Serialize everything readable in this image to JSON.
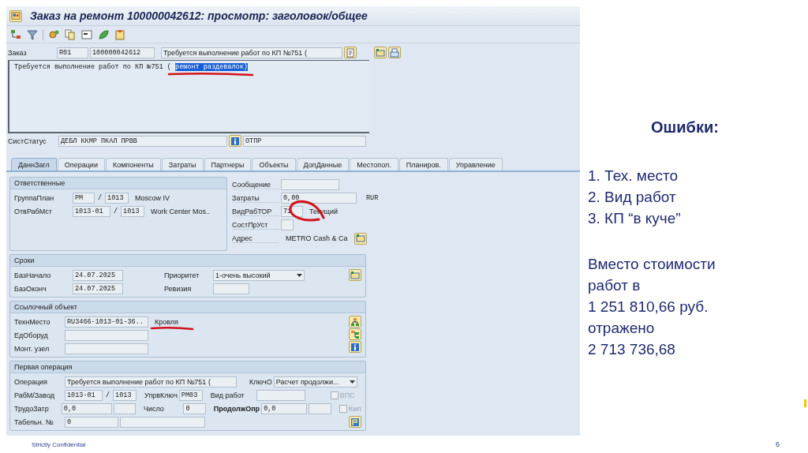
{
  "window": {
    "title": "Заказ на ремонт 100000042612: просмотр: заголовок/общее"
  },
  "header": {
    "order_label": "Заказ",
    "order_type": "R01",
    "order_number": "100000042612",
    "short_text": "Требуется выполнение работ по КП №751 (",
    "long_text": [
      {
        "text": "Требуется выполнение работ по КП №751 ( ",
        "selected": false
      },
      {
        "text": "ремонт раздевалок)",
        "selected": true
      }
    ],
    "status_label": "СистСтатус",
    "system_status": "ДЕБЛ ККМР ПКАЛ ПРВВ",
    "user_status": "ОТПР"
  },
  "tabs": [
    {
      "label": "ДаннЗагл",
      "selected": true
    },
    {
      "label": "Операции",
      "selected": false
    },
    {
      "label": "Компоненты",
      "selected": false
    },
    {
      "label": "Затраты",
      "selected": false
    },
    {
      "label": "Партнеры",
      "selected": false
    },
    {
      "label": "Объекты",
      "selected": false
    },
    {
      "label": "ДопДанные",
      "selected": false
    },
    {
      "label": "Местопол.",
      "selected": false
    },
    {
      "label": "Планиров.",
      "selected": false
    },
    {
      "label": "Управление",
      "selected": false
    }
  ],
  "responsible": {
    "title": "Ответственные",
    "rows": [
      {
        "label": "ГруппаПлан",
        "value": "PM",
        "sep": "/",
        "plant": "1013",
        "desc": "Moscow IV"
      },
      {
        "label": "ОтвРабМст",
        "value": "1013-01",
        "sep": "/",
        "plant": "1013",
        "desc": "Work Center Mos.."
      }
    ]
  },
  "side_fields": [
    {
      "kind": "field",
      "label": "Сообщение"
    },
    {
      "kind": "unit",
      "label": "Затраты",
      "value": "0,00",
      "unit": "RUR"
    },
    {
      "kind": "code",
      "label": "ВидРабТОР",
      "value": "71",
      "desc": "Текущий"
    },
    {
      "kind": "small",
      "label": "СостПрУст"
    },
    {
      "kind": "text",
      "label": "Адрес",
      "value": "METRO Cash & Ca"
    }
  ],
  "dates": {
    "title": "Сроки",
    "start_label": "БазНачало",
    "start": "24.07.2025",
    "end_label": "БазОконч",
    "end": "24.07.2025",
    "priority_label": "Приоритет",
    "priority": "1-очень высокий",
    "revision_label": "Ревизия"
  },
  "reference": {
    "title": "Ссылочный объект",
    "funcloc_label": "ТехнМесто",
    "funcloc": "RU3466-1013-01-36..",
    "funcloc_desc": "Кровля",
    "equipment_label": "ЕдОборуд",
    "assembly_label": "Монт. узел"
  },
  "operation": {
    "title": "Первая операция",
    "op_label": "Операция",
    "op_text": "Требуется выполнение работ по КП №751 (",
    "key_label": "КлючО",
    "key_value": "Расчет продолжи...",
    "wc_label": "РабМ/Завод",
    "wc": "1013-01",
    "sep": "/",
    "plant": "1013",
    "ctrl_label": "УпрвКлюч",
    "ctrl": "PM03",
    "acttype_label": "Вид работ",
    "vps_label": "ВПС",
    "vps_checked": false,
    "vps_disabled": true,
    "work_label": "ТрудоЗатр",
    "work": "0,0",
    "number_label": "Число",
    "number": "0",
    "duration_label": "ПродолжОпр",
    "duration": "0,0",
    "kmp_label": "Кмп",
    "kmp_checked": false,
    "kmp_disabled": true,
    "personnel_label": "Табельн. №",
    "personnel": "0"
  },
  "notes": {
    "title": "Ошибки:",
    "errors": [
      "1. Тех. место",
      "2. Вид работ",
      "3. КП “в куче”"
    ],
    "summary": "Вместо стоимости\nработ в\n1 251 810,66 руб.\nотражено\n2 713 736,68"
  },
  "footer": {
    "confidential": "Strictly Confidential",
    "page": "6"
  }
}
